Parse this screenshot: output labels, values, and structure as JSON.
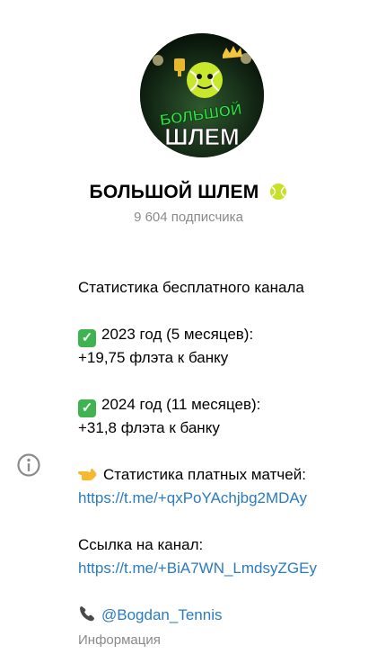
{
  "channel": {
    "title": "БОЛЬШОЙ ШЛЕМ",
    "subscribers": "9 604 подписчика",
    "avatar_text_line1": "БОЛЬШОЙ",
    "avatar_text_line2": "ШЛЕМ"
  },
  "description": {
    "stats_header": "Статистика бесплатного канала",
    "year2023": "2023 год (5 месяцев):",
    "year2023_result": "+19,75 флэта к банку",
    "year2024": "2024 год (11 месяцев):",
    "year2024_result": "+31,8 флэта к банку",
    "paid_stats_label": "Статистика платных матчей:",
    "paid_stats_link": "https://t.me/+qxPoYAchjbg2MDAy",
    "channel_link_label": "Ссылка на канал:",
    "channel_link": "https://t.me/+BiA7WN_LmdsyZGEy",
    "contact": "@Bogdan_Tennis"
  },
  "info_label": "Информация",
  "icons": {
    "info": "info-icon",
    "check": "check-mark-icon",
    "pointing": "pointing-hand-icon",
    "phone": "phone-icon",
    "tennis": "tennis-ball-icon"
  },
  "colors": {
    "link": "#2a7bc0",
    "muted": "#8a8a8a",
    "check_bg": "#3fb34f",
    "avatar_green": "#39e14a"
  }
}
